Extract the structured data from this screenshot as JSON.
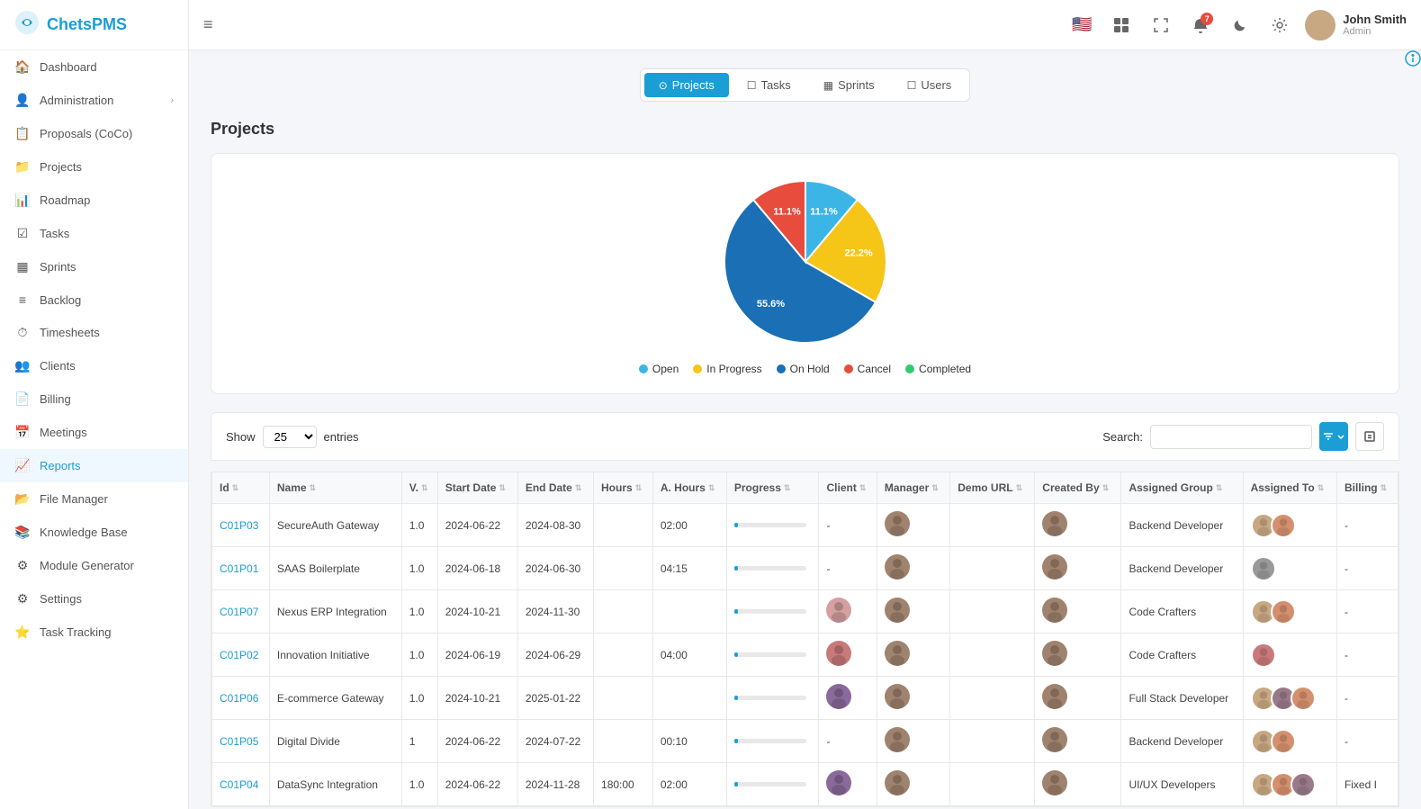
{
  "logo": {
    "text": "ChetsPMS",
    "icon": "⚙"
  },
  "sidebar": {
    "items": [
      {
        "id": "dashboard",
        "label": "Dashboard",
        "icon": "🏠"
      },
      {
        "id": "administration",
        "label": "Administration",
        "icon": "👤",
        "hasArrow": true
      },
      {
        "id": "proposals",
        "label": "Proposals (CoCo)",
        "icon": "📋"
      },
      {
        "id": "projects",
        "label": "Projects",
        "icon": "📁"
      },
      {
        "id": "roadmap",
        "label": "Roadmap",
        "icon": "📊"
      },
      {
        "id": "tasks",
        "label": "Tasks",
        "icon": "☑"
      },
      {
        "id": "sprints",
        "label": "Sprints",
        "icon": "▦"
      },
      {
        "id": "backlog",
        "label": "Backlog",
        "icon": "≡"
      },
      {
        "id": "timesheets",
        "label": "Timesheets",
        "icon": "⏱"
      },
      {
        "id": "clients",
        "label": "Clients",
        "icon": "👥"
      },
      {
        "id": "billing",
        "label": "Billing",
        "icon": "📄"
      },
      {
        "id": "meetings",
        "label": "Meetings",
        "icon": "📅"
      },
      {
        "id": "reports",
        "label": "Reports",
        "icon": "📈",
        "active": true
      },
      {
        "id": "file-manager",
        "label": "File Manager",
        "icon": "📂"
      },
      {
        "id": "knowledge-base",
        "label": "Knowledge Base",
        "icon": "📚"
      },
      {
        "id": "module-generator",
        "label": "Module Generator",
        "icon": "⚙"
      },
      {
        "id": "settings",
        "label": "Settings",
        "icon": "⚙"
      },
      {
        "id": "task-tracking",
        "label": "Task Tracking",
        "icon": "⭐"
      }
    ]
  },
  "topbar": {
    "menu_icon": "≡",
    "notification_count": "7",
    "user": {
      "name": "John Smith",
      "role": "Admin"
    }
  },
  "tabs": [
    {
      "id": "projects",
      "label": "Projects",
      "icon": "⊙",
      "active": true
    },
    {
      "id": "tasks",
      "label": "Tasks",
      "icon": "☐"
    },
    {
      "id": "sprints",
      "label": "Sprints",
      "icon": "▦"
    },
    {
      "id": "users",
      "label": "Users",
      "icon": "☐"
    }
  ],
  "page_title": "Projects",
  "chart": {
    "segments": [
      {
        "label": "Open",
        "percent": 11.1,
        "color": "#3ab5e6",
        "start": 0
      },
      {
        "label": "In Progress",
        "percent": 22.2,
        "color": "#f5c518",
        "start": 11.1
      },
      {
        "label": "On Hold",
        "percent": 55.6,
        "color": "#1a6fb5",
        "start": 33.3
      },
      {
        "label": "Cancel",
        "percent": 11.1,
        "color": "#e74c3c",
        "start": 88.9
      },
      {
        "label": "Completed",
        "percent": 0,
        "color": "#2ecc71",
        "start": 100
      }
    ],
    "legend": [
      {
        "label": "Open",
        "color": "#3ab5e6"
      },
      {
        "label": "In Progress",
        "color": "#f5c518"
      },
      {
        "label": "On Hold",
        "color": "#1a6fb5"
      },
      {
        "label": "Cancel",
        "color": "#e74c3c"
      },
      {
        "label": "Completed",
        "color": "#2ecc71"
      }
    ]
  },
  "table_controls": {
    "show_label": "Show",
    "show_value": "25",
    "entries_label": "entries",
    "search_label": "Search:",
    "search_placeholder": ""
  },
  "table": {
    "columns": [
      "Id",
      "Name",
      "V.",
      "Start Date",
      "End Date",
      "Hours",
      "A. Hours",
      "Progress",
      "Client",
      "Manager",
      "Demo URL",
      "Created By",
      "Assigned Group",
      "Assigned To",
      "Billing"
    ],
    "rows": [
      {
        "id": "C01P03",
        "name": "SecureAuth Gateway",
        "v": "1.0",
        "start": "2024-06-22",
        "end": "2024-08-30",
        "hours": "",
        "a_hours": "02:00",
        "progress": 5,
        "client": "-",
        "manager": true,
        "demo_url": "",
        "created_by": true,
        "assigned_group": "Backend Developer",
        "assigned_to": "multi",
        "billing": "-"
      },
      {
        "id": "C01P01",
        "name": "SAAS Boilerplate",
        "v": "1.0",
        "start": "2024-06-18",
        "end": "2024-06-30",
        "hours": "",
        "a_hours": "04:15",
        "progress": 5,
        "client": "-",
        "manager": true,
        "demo_url": "",
        "created_by": true,
        "assigned_group": "Backend Developer",
        "assigned_to": "single",
        "billing": "-"
      },
      {
        "id": "C01P07",
        "name": "Nexus ERP Integration",
        "v": "1.0",
        "start": "2024-10-21",
        "end": "2024-11-30",
        "hours": "",
        "a_hours": "",
        "progress": 5,
        "client": "avatar",
        "manager": true,
        "demo_url": "",
        "created_by": true,
        "assigned_group": "Code Crafters",
        "assigned_to": "multi",
        "billing": "-"
      },
      {
        "id": "C01P02",
        "name": "Innovation Initiative",
        "v": "1.0",
        "start": "2024-06-19",
        "end": "2024-06-29",
        "hours": "",
        "a_hours": "04:00",
        "progress": 5,
        "client": "avatar2",
        "manager": true,
        "demo_url": "",
        "created_by": true,
        "assigned_group": "Code Crafters",
        "assigned_to": "single2",
        "billing": "-"
      },
      {
        "id": "C01P06",
        "name": "E-commerce Gateway",
        "v": "1.0",
        "start": "2024-10-21",
        "end": "2025-01-22",
        "hours": "",
        "a_hours": "",
        "progress": 5,
        "client": "avatar3",
        "manager": true,
        "demo_url": "",
        "created_by": true,
        "assigned_group": "Full Stack Developer",
        "assigned_to": "multi2",
        "billing": "-"
      },
      {
        "id": "C01P05",
        "name": "Digital Divide",
        "v": "1",
        "start": "2024-06-22",
        "end": "2024-07-22",
        "hours": "",
        "a_hours": "00:10",
        "progress": 5,
        "client": "-",
        "manager": true,
        "demo_url": "",
        "created_by": true,
        "assigned_group": "Backend Developer",
        "assigned_to": "multi",
        "billing": "-"
      },
      {
        "id": "C01P04",
        "name": "DataSync Integration",
        "v": "1.0",
        "start": "2024-06-22",
        "end": "2024-11-28",
        "hours": "180:00",
        "a_hours": "02:00",
        "progress": 5,
        "client": "avatar4",
        "manager": true,
        "demo_url": "",
        "created_by": true,
        "assigned_group": "UI/UX Developers",
        "assigned_to": "multi3",
        "billing": "Fixed I"
      }
    ]
  }
}
